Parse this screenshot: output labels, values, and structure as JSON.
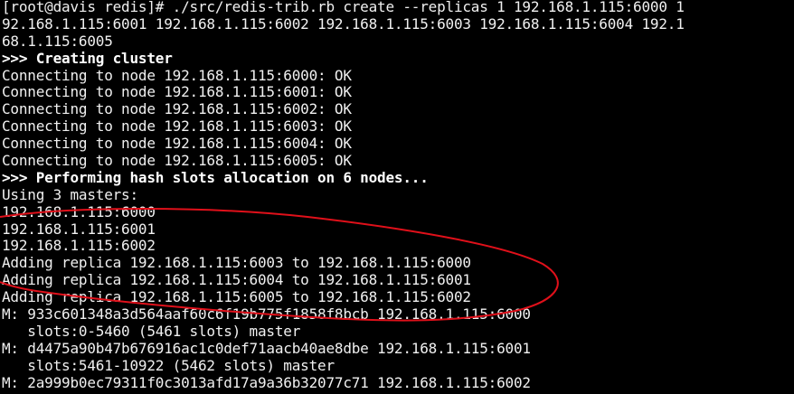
{
  "terminal": {
    "lines": [
      "[root@davis redis]# ./src/redis-trib.rb create --replicas 1 192.168.1.115:6000 192.168.1.115:6001 192.168.1.115:6002 192.168.1.115:6003 192.168.1.115:6004 192.168.1.115:6005",
      "",
      "",
      ">>> Creating cluster",
      "Connecting to node 192.168.1.115:6000: OK",
      "Connecting to node 192.168.1.115:6001: OK",
      "Connecting to node 192.168.1.115:6002: OK",
      "Connecting to node 192.168.1.115:6003: OK",
      "Connecting to node 192.168.1.115:6004: OK",
      "Connecting to node 192.168.1.115:6005: OK",
      ">>> Performing hash slots allocation on 6 nodes...",
      "Using 3 masters:",
      "192.168.1.115:6000",
      "192.168.1.115:6001",
      "192.168.1.115:6002",
      "Adding replica 192.168.1.115:6003 to 192.168.1.115:6000",
      "Adding replica 192.168.1.115:6004 to 192.168.1.115:6001",
      "Adding replica 192.168.1.115:6005 to 192.168.1.115:6002",
      "M: 933c601348a3d564aaf60c6f19b775f1858f8bcb 192.168.1.115:6000",
      "   slots:0-5460 (5461 slots) master",
      "M: d4475a90b47b676916ac1c0def71aacb40ae8dbe 192.168.1.115:6001",
      "   slots:5461-10922 (5462 slots) master",
      "M: 2a999b0ec79311f0c3013afd17a9a36b32077c71 192.168.1.115:6002"
    ],
    "wrapped_lines": [
      "[root@davis redis]# ./src/redis-trib.rb create --replicas 1 192.168.1.115:6000 1",
      "92.168.1.115:6001 192.168.1.115:6002 192.168.1.115:6003 192.168.1.115:6004 192.1",
      "68.1.115:6005"
    ],
    "colors": {
      "background": "#000000",
      "text": "#f0f0f0",
      "annotation": "#e0101a"
    }
  }
}
